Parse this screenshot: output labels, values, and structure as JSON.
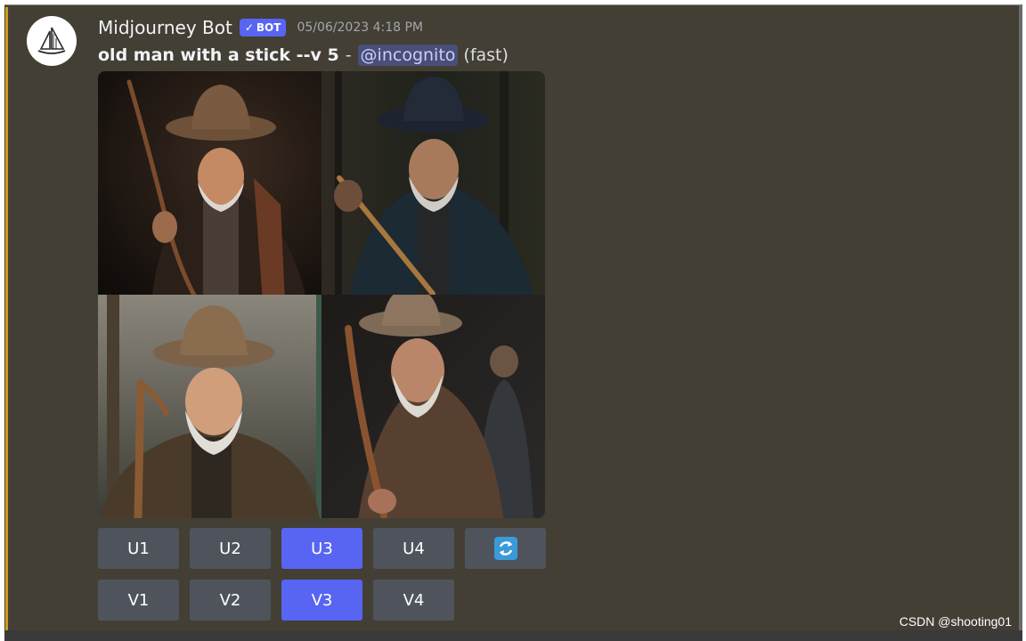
{
  "message": {
    "author": "Midjourney Bot",
    "bot_tag": "BOT",
    "bot_check": "✓",
    "timestamp": "05/06/2023 4:18 PM",
    "prompt": "old man with a stick --v 5",
    "separator": "-",
    "mention": "@incognito",
    "speed": "(fast)"
  },
  "image_grid": {
    "images": [
      {
        "description": "old man with hat and wooden stick, dark background"
      },
      {
        "description": "old man with dark hat holding a stick outdoors"
      },
      {
        "description": "smiling old man with brown hat and stick"
      },
      {
        "description": "bearded old man with hat walking with stick"
      }
    ]
  },
  "buttons": {
    "upscale": [
      {
        "label": "U1",
        "active": false
      },
      {
        "label": "U2",
        "active": false
      },
      {
        "label": "U3",
        "active": true
      },
      {
        "label": "U4",
        "active": false
      }
    ],
    "reroll_icon": "refresh-icon",
    "variation": [
      {
        "label": "V1",
        "active": false
      },
      {
        "label": "V2",
        "active": false
      },
      {
        "label": "V3",
        "active": true
      },
      {
        "label": "V4",
        "active": false
      }
    ]
  },
  "watermark": "CSDN @shooting01",
  "colors": {
    "background": "#433f35",
    "highlight_bar": "#d29c1a",
    "button": "#4f545c",
    "button_active": "#5865f2",
    "bot_tag": "#5865f2"
  }
}
